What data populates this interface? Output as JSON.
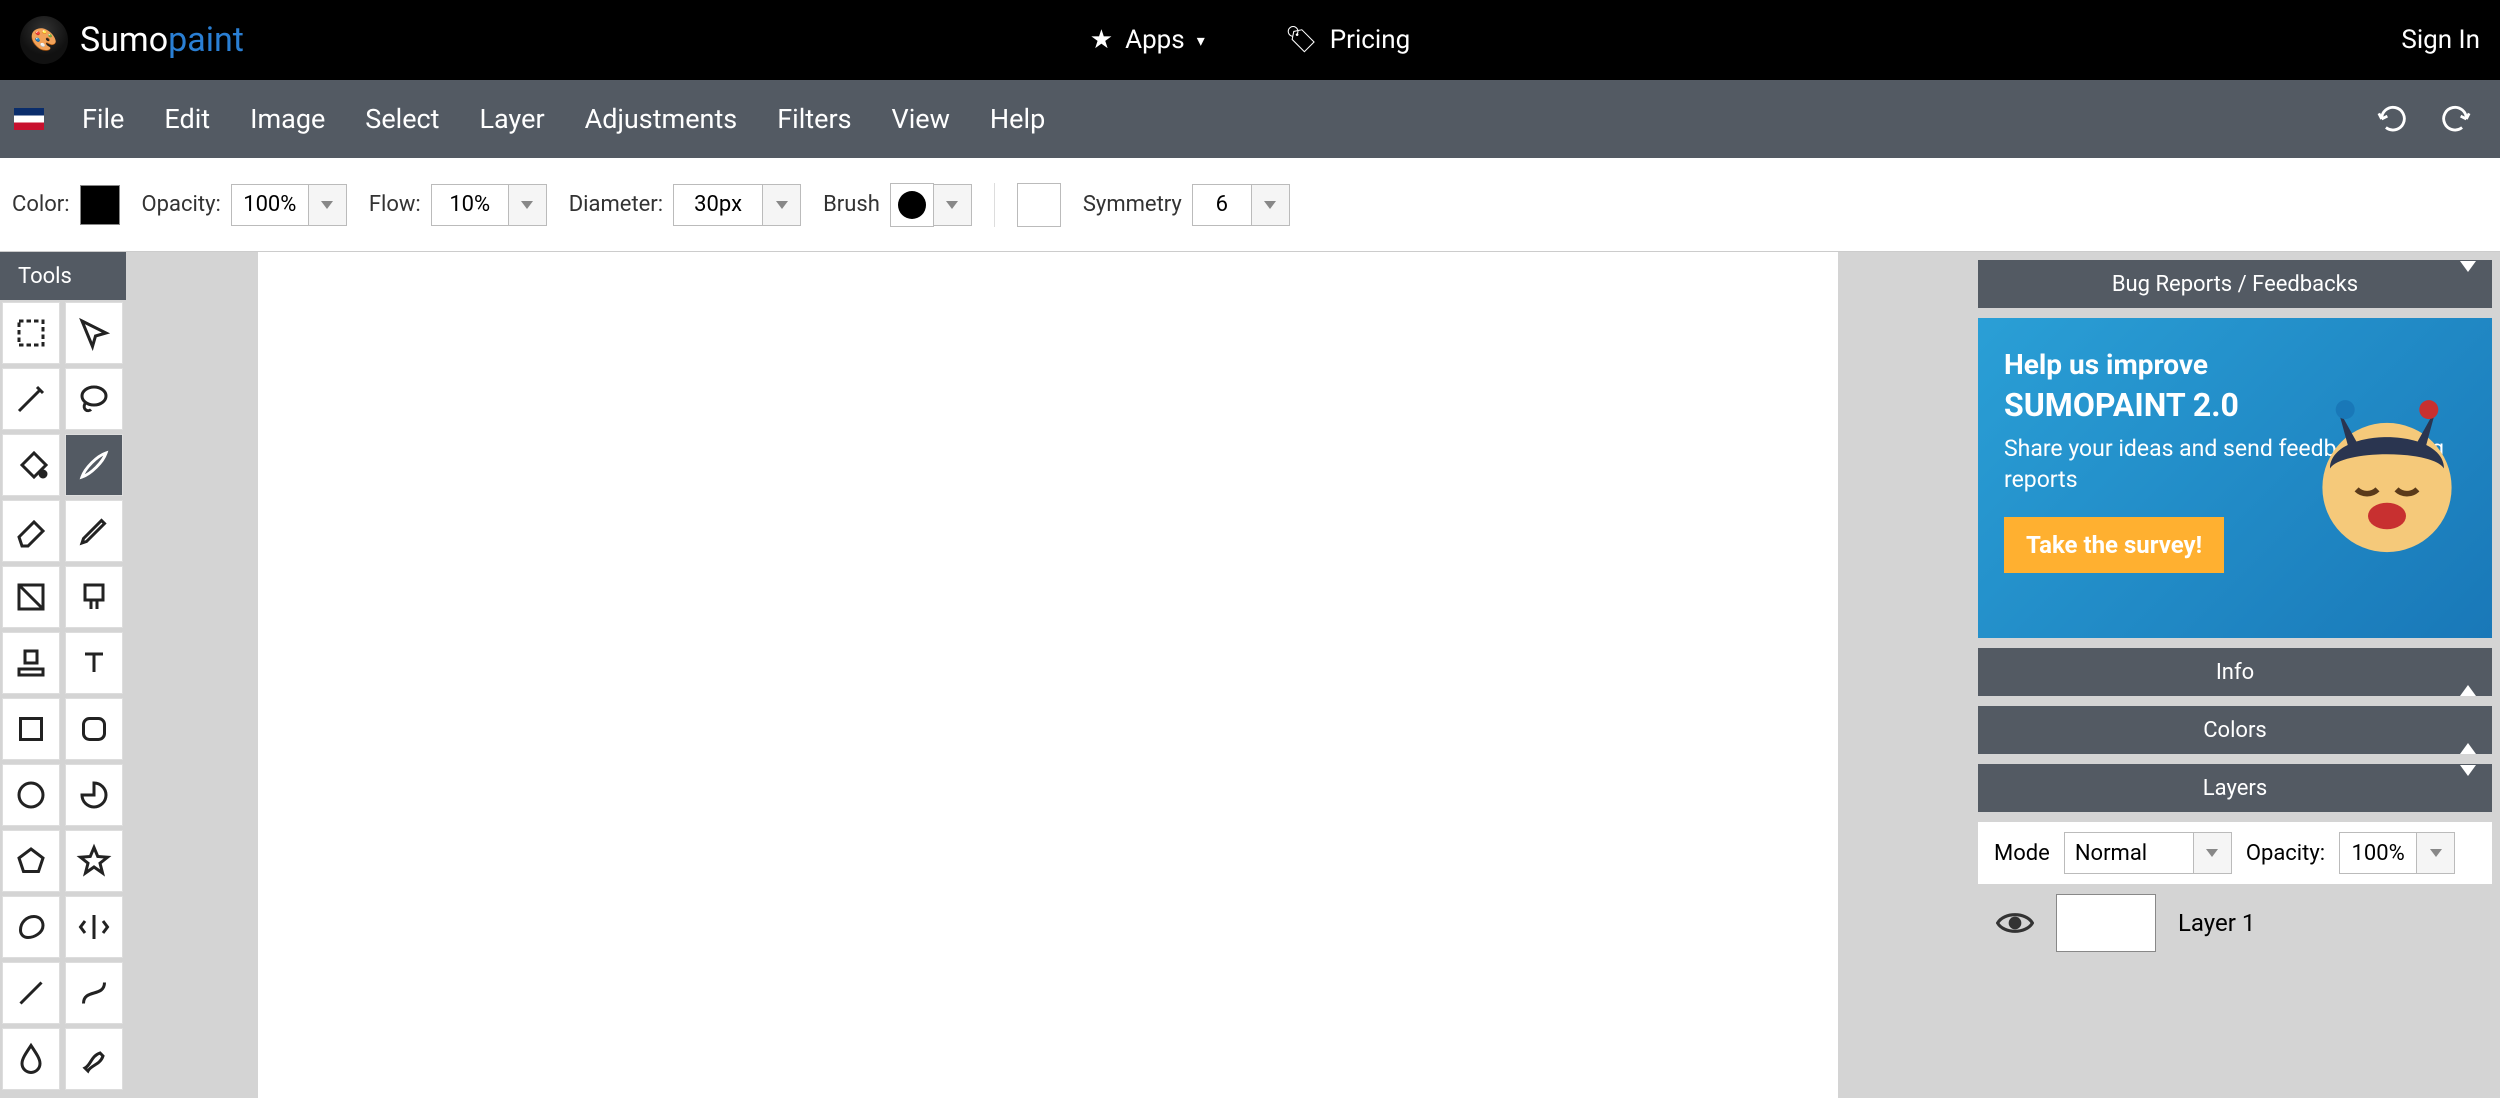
{
  "header": {
    "logo_a": "Sumo",
    "logo_b": "paint",
    "apps": "Apps",
    "pricing": "Pricing",
    "signin": "Sign In"
  },
  "menu": {
    "items": [
      "File",
      "Edit",
      "Image",
      "Select",
      "Layer",
      "Adjustments",
      "Filters",
      "View",
      "Help"
    ]
  },
  "optbar": {
    "color_label": "Color:",
    "opacity_label": "Opacity:",
    "opacity_value": "100%",
    "flow_label": "Flow:",
    "flow_value": "10%",
    "diameter_label": "Diameter:",
    "diameter_value": "30px",
    "brush_label": "Brush",
    "symmetry_label": "Symmetry",
    "symmetry_value": "6"
  },
  "tools": {
    "title": "Tools"
  },
  "right": {
    "bug_title": "Bug Reports / Feedbacks",
    "banner_l1": "Help us improve",
    "banner_l2": "SUMOPAINT 2.0",
    "banner_l3": "Share your ideas and send feedbacks / bug reports",
    "banner_cta": "Take the survey!",
    "info_title": "Info",
    "colors_title": "Colors",
    "layers_title": "Layers",
    "mode_label": "Mode",
    "mode_value": "Normal",
    "layer_opacity_label": "Opacity:",
    "layer_opacity_value": "100%",
    "layer1_name": "Layer 1"
  }
}
